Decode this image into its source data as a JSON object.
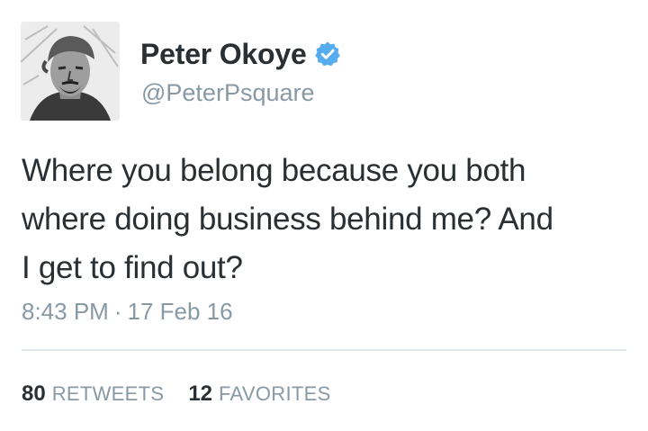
{
  "tweet": {
    "author": {
      "display_name": "Peter Okoye",
      "handle": "@PeterPsquare",
      "verified": true,
      "avatar_icon": "sketch-portrait-avatar"
    },
    "text_lines": [
      "Where you belong because you both",
      "where doing business behind me? And",
      "I get to find out?"
    ],
    "time": "8:43 PM",
    "separator": "·",
    "date": "17 Feb 16",
    "stats": {
      "retweets_count": "80",
      "retweets_label": "RETWEETS",
      "favorites_count": "12",
      "favorites_label": "FAVORITES"
    }
  },
  "colors": {
    "text_primary": "#292f33",
    "text_secondary": "#8899a6",
    "verified_badge": "#55acee",
    "divider": "#e1e8ed"
  }
}
